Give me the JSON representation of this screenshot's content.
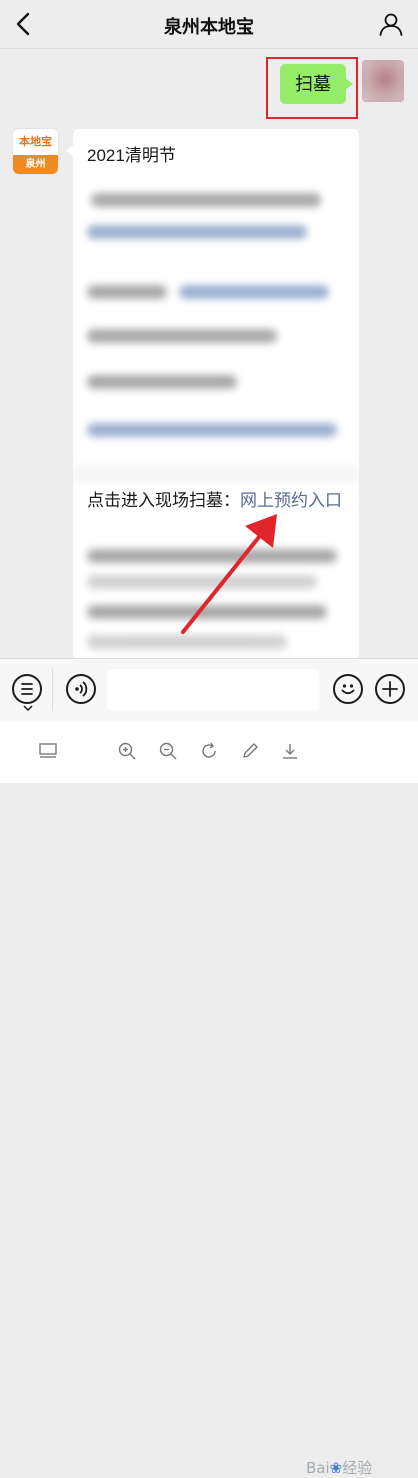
{
  "nav": {
    "title": "泉州本地宝",
    "back_icon": "chevron-left-icon",
    "profile_icon": "person-icon"
  },
  "chat": {
    "my_message": "扫墓",
    "official_avatar": {
      "top_text": "本地宝",
      "bottom_text": "泉州"
    },
    "article": {
      "title": "2021清明节",
      "link_prefix": "点击进入现场扫墓：",
      "link_text": "网上预约入口"
    }
  },
  "input_bar": {
    "menu_icon": "menu-list-icon",
    "voice_icon": "voice-icon",
    "emoji_icon": "emoji-icon",
    "plus_icon": "plus-icon",
    "input_value": ""
  },
  "toolbar": {
    "icons": [
      "layout-icon",
      "zoom-in-icon",
      "zoom-out-icon",
      "rotate-icon",
      "pen-icon",
      "download-icon"
    ]
  },
  "watermark": {
    "text": "Bai",
    "suffix": "经验"
  },
  "colors": {
    "accent_green": "#95ec69",
    "link_blue": "#576b95",
    "highlight_red": "#e0262b",
    "brand_orange": "#f08a23"
  }
}
